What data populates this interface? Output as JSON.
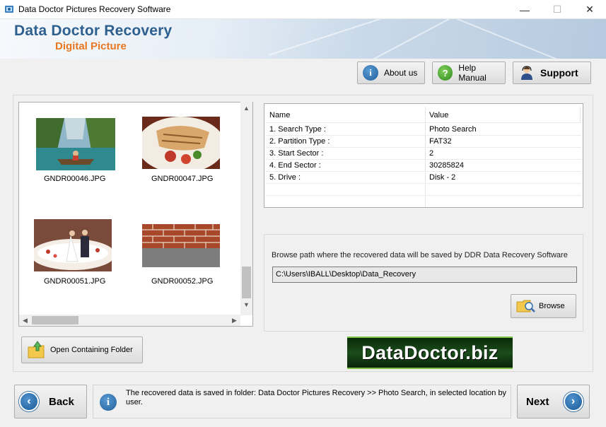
{
  "window": {
    "title": "Data Doctor Pictures Recovery Software",
    "minimize_glyph": "—",
    "maximize_glyph": "☐",
    "close_glyph": "✕"
  },
  "banner": {
    "brand": "Data Doctor Recovery",
    "product": "Digital Picture"
  },
  "toolbar": {
    "about_label": "About us",
    "help_label": "Help Manual",
    "support_label": "Support"
  },
  "gallery": {
    "items": [
      {
        "filename": "GNDR00046.JPG",
        "icon": "boat-lake-photo"
      },
      {
        "filename": "GNDR00047.JPG",
        "icon": "food-plate-photo"
      },
      {
        "filename": "GNDR00051.JPG",
        "icon": "wedding-cake-photo"
      },
      {
        "filename": "GNDR00052.JPG",
        "icon": "brick-wall-photo"
      }
    ]
  },
  "properties": {
    "columns": [
      "Name",
      "Value"
    ],
    "rows": [
      {
        "name": "1. Search Type :",
        "value": "Photo Search"
      },
      {
        "name": "2. Partition Type :",
        "value": "FAT32"
      },
      {
        "name": "3. Start Sector :",
        "value": "2"
      },
      {
        "name": "4. End Sector :",
        "value": "30285824"
      },
      {
        "name": "5. Drive :",
        "value": "Disk - 2"
      }
    ]
  },
  "save": {
    "hint": "Browse path where the recovered data will be saved by DDR Data Recovery Software",
    "path": "C:\\Users\\IBALL\\Desktop\\Data_Recovery",
    "browse_label": "Browse"
  },
  "open_folder_label": "Open Containing Folder",
  "logo_text": "DataDoctor.biz",
  "nav": {
    "back_label": "Back",
    "next_label": "Next",
    "status_message": "The recovered data is saved in folder: Data Doctor Pictures Recovery  >> Photo Search, in selected location by user."
  },
  "colors": {
    "brand_blue": "#2d5f8f",
    "brand_orange": "#e87722",
    "logo_green": "#1b4d1b"
  }
}
